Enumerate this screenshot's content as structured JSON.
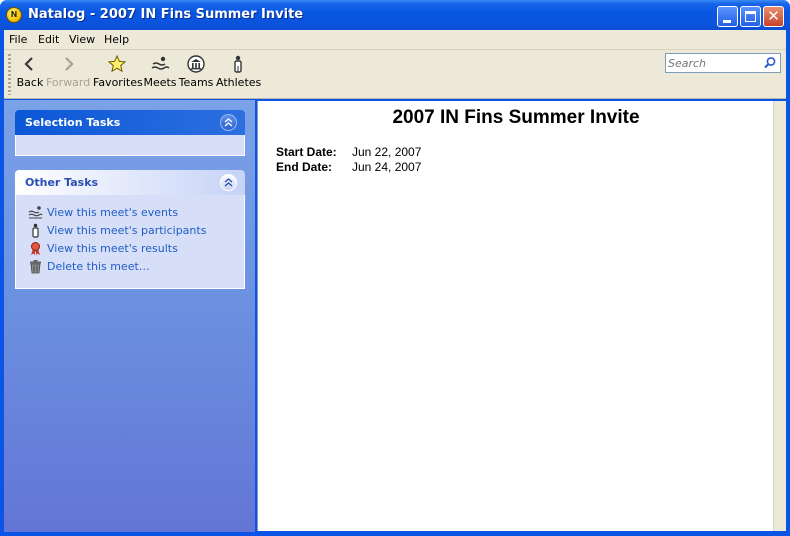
{
  "window": {
    "app_icon_letter": "N",
    "title": "Natalog - 2007 IN Fins Summer Invite",
    "controls": {
      "close_glyph": "✕"
    }
  },
  "menu": [
    "File",
    "Edit",
    "View",
    "Help"
  ],
  "toolbar": {
    "buttons": [
      {
        "label": "Back",
        "icon": "back-arrow-icon",
        "enabled": true
      },
      {
        "label": "Forward",
        "icon": "forward-arrow-icon",
        "enabled": false
      },
      {
        "label": "Favorites",
        "icon": "star-icon",
        "enabled": true
      },
      {
        "label": "Meets",
        "icon": "meets-icon",
        "enabled": true
      },
      {
        "label": "Teams",
        "icon": "teams-icon",
        "enabled": true
      },
      {
        "label": "Athletes",
        "icon": "athlete-icon",
        "enabled": true
      }
    ],
    "search_placeholder": "Search"
  },
  "taskpane": {
    "selection_tasks": {
      "title": "Selection Tasks"
    },
    "other_tasks": {
      "title": "Other Tasks",
      "items": [
        {
          "label": "View this meet's events",
          "icon": "events-icon"
        },
        {
          "label": "View this meet's participants",
          "icon": "participants-icon"
        },
        {
          "label": "View this meet's results",
          "icon": "ribbon-icon"
        },
        {
          "label": "Delete this meet…",
          "icon": "trash-icon"
        }
      ]
    }
  },
  "meet": {
    "name": "2007 IN Fins Summer Invite",
    "start_label": "Start Date:",
    "start_date": "Jun 22, 2007",
    "end_label": "End Date:",
    "end_date": "Jun 24, 2007"
  },
  "colors": {
    "titlebar": "#0a54df",
    "taskpane_top": "#7ba2e7",
    "taskpane_bottom": "#6375d6",
    "link": "#215dc6",
    "chrome": "#ece9d8"
  }
}
